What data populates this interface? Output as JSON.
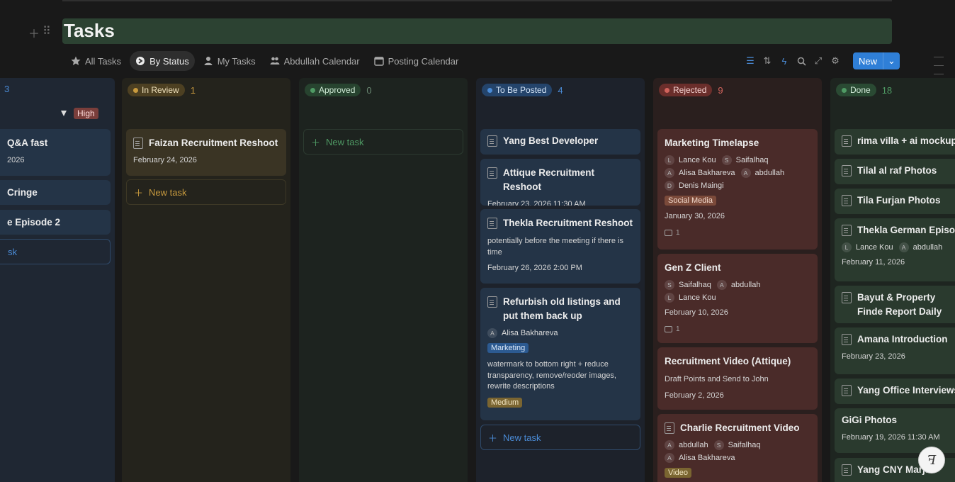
{
  "page": {
    "title": "Tasks"
  },
  "tabs": [
    {
      "label": "All Tasks",
      "icon": "star-icon"
    },
    {
      "label": "By Status",
      "icon": "status-icon",
      "active": true
    },
    {
      "label": "My Tasks",
      "icon": "person-icon"
    },
    {
      "label": "Abdullah Calendar",
      "icon": "people-icon"
    },
    {
      "label": "Posting Calendar",
      "icon": "calendar-icon"
    }
  ],
  "toolbar": {
    "new_label": "New"
  },
  "group": {
    "label": "High"
  },
  "columns": {
    "first": {
      "count": "3",
      "new_task": "sk",
      "cards": [
        {
          "title": "Q&A fast",
          "date": "2026"
        },
        {
          "title": "Cringe"
        },
        {
          "title": "e Episode 2"
        }
      ]
    },
    "in_review": {
      "label": "In Review",
      "count": "1",
      "new_task": "New task",
      "cards": [
        {
          "title": "Faizan Recruitment Reshoot",
          "date": "February 24, 2026"
        }
      ]
    },
    "approved": {
      "label": "Approved",
      "count": "0",
      "new_task": "New task"
    },
    "to_be_posted": {
      "label": "To Be Posted",
      "count": "4",
      "new_task": "New task",
      "cards": [
        {
          "title": "Yang Best Developer"
        },
        {
          "title": "Attique Recruitment Reshoot",
          "date": "February 23, 2026 11:30 AM"
        },
        {
          "title": "Thekla Recruitment Reshoot",
          "desc": "potentially before the meeting if there is time",
          "date": "February 26, 2026 2:00 PM"
        },
        {
          "title": "Refurbish old listings and put them back up",
          "person": "Alisa Bakhareva",
          "person_initial": "A",
          "tag": "Marketing",
          "desc": "watermark to bottom right + reduce transparency, remove/reoder images, rewrite descriptions",
          "tag2": "Medium"
        }
      ]
    },
    "rejected": {
      "label": "Rejected",
      "count": "9",
      "cards": [
        {
          "title": "Marketing Timelapse",
          "people": [
            {
              "i": "L",
              "n": "Lance Kou"
            },
            {
              "i": "S",
              "n": "Saifalhaq"
            },
            {
              "i": "A",
              "n": "Alisa Bakhareva"
            },
            {
              "i": "A",
              "n": "abdullah"
            },
            {
              "i": "D",
              "n": "Denis Maingi"
            }
          ],
          "tag": "Social Media",
          "date": "January 30, 2026",
          "comments": "1"
        },
        {
          "title": "Gen Z Client",
          "people": [
            {
              "i": "S",
              "n": "Saifalhaq"
            },
            {
              "i": "A",
              "n": "abdullah"
            },
            {
              "i": "L",
              "n": "Lance Kou"
            }
          ],
          "date": "February 10, 2026",
          "comments": "1"
        },
        {
          "title": "Recruitment Video (Attique)",
          "desc": "Draft Points and Send to John",
          "date": "February 2, 2026"
        },
        {
          "title": "Charlie Recruitment Video",
          "people": [
            {
              "i": "A",
              "n": "abdullah"
            },
            {
              "i": "S",
              "n": "Saifalhaq"
            },
            {
              "i": "A",
              "n": "Alisa Bakhareva"
            }
          ],
          "tag": "Video"
        }
      ]
    },
    "done": {
      "label": "Done",
      "count": "18",
      "cards": [
        {
          "title": "rima villa + ai mockups"
        },
        {
          "title": "Tilal al raf Photos"
        },
        {
          "title": "Tila Furjan Photos"
        },
        {
          "title": "Thekla German Episod",
          "people": [
            {
              "i": "L",
              "n": "Lance Kou"
            },
            {
              "i": "A",
              "n": "abdullah"
            }
          ],
          "date": "February 11, 2026"
        },
        {
          "title": "Bayut & Property Finde Report Daily"
        },
        {
          "title": "Amana Introduction",
          "date": "February 23, 2026"
        },
        {
          "title": "Yang Office Interviews"
        },
        {
          "title": "GiGi Photos",
          "date": "February 19, 2026 11:30 AM"
        },
        {
          "title": "Yang CNY Marjan"
        }
      ]
    }
  },
  "colors": {
    "blue": "#2f7fd7",
    "review": "#b08a3a",
    "approved": "#3f8a57",
    "rejected": "#c2504a",
    "done": "#4f9a64"
  }
}
